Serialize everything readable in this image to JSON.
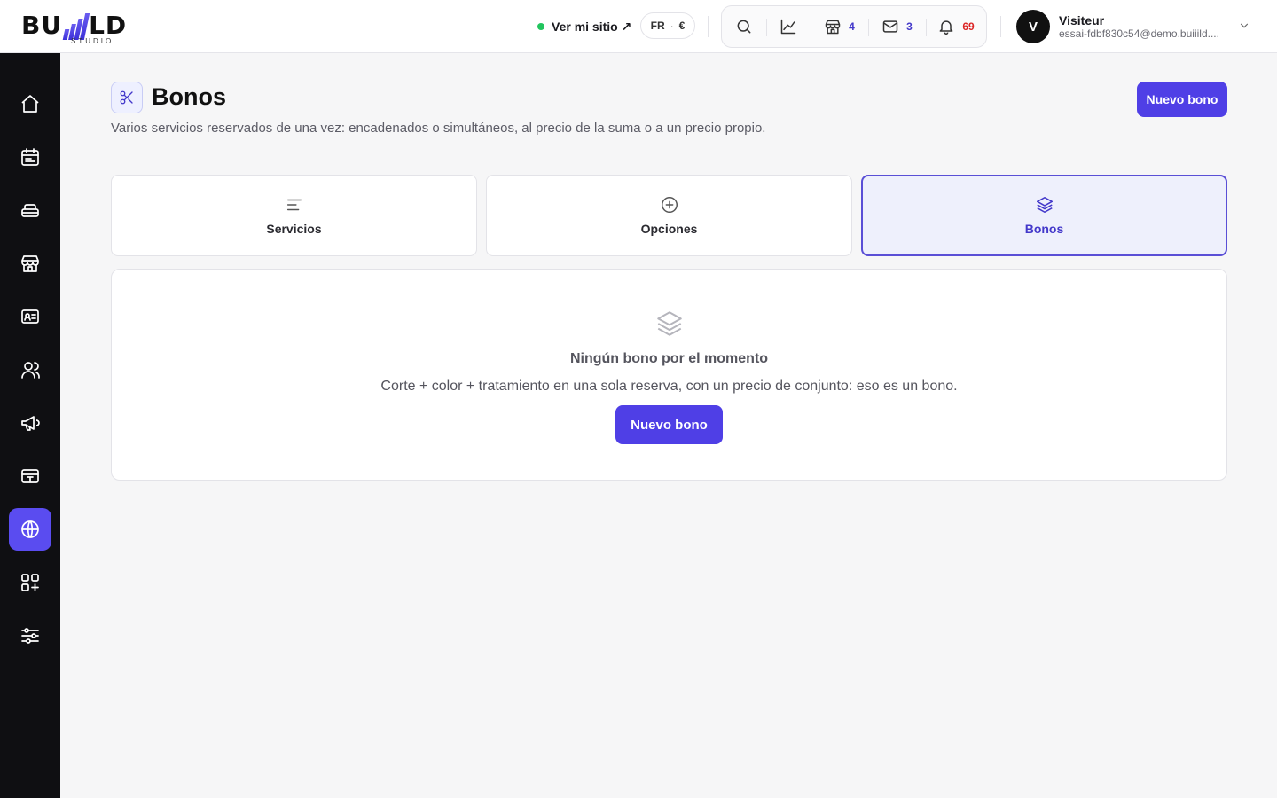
{
  "brand": {
    "logo_left": "BU",
    "logo_right": "LD",
    "logo_sub": "STUDIO"
  },
  "header": {
    "site_link": "Ver mi sitio ↗",
    "language": "FR",
    "currency": "€",
    "badges": {
      "shop": "4",
      "mail": "3",
      "notifications": "69"
    },
    "status_color": "#22c55e"
  },
  "user": {
    "initial": "V",
    "name": "Visiteur",
    "email": "essai-fdbf830c54@demo.buiiild...."
  },
  "sidebar": {
    "items": [
      {
        "name": "home",
        "icon": "home-icon"
      },
      {
        "name": "calendar",
        "icon": "calendar-icon"
      },
      {
        "name": "services",
        "icon": "spa-bed-icon"
      },
      {
        "name": "shop",
        "icon": "store-icon"
      },
      {
        "name": "contacts",
        "icon": "id-card-icon"
      },
      {
        "name": "team",
        "icon": "users-icon"
      },
      {
        "name": "marketing",
        "icon": "megaphone-icon"
      },
      {
        "name": "payments",
        "icon": "card-icon"
      },
      {
        "name": "website",
        "icon": "globe-icon",
        "active": true
      },
      {
        "name": "apps",
        "icon": "apps-add-icon"
      },
      {
        "name": "settings",
        "icon": "sliders-icon"
      }
    ],
    "accent": "#5a4cf0"
  },
  "page": {
    "title": "Bonos",
    "description": "Varios servicios reservados de una vez: encadenados o simultáneos, al precio de la suma o a un precio propio.",
    "new_button": "Nuevo bono"
  },
  "tabs": [
    {
      "label": "Servicios",
      "icon": "lines-icon"
    },
    {
      "label": "Opciones",
      "icon": "plus-circle-icon"
    },
    {
      "label": "Bonos",
      "icon": "layers-icon",
      "active": true
    }
  ],
  "empty_state": {
    "title": "Ningún bono por el momento",
    "description": "Corte + color + tratamiento en una sola reserva, con un precio de conjunto: eso es un bono.",
    "button": "Nuevo bono"
  }
}
